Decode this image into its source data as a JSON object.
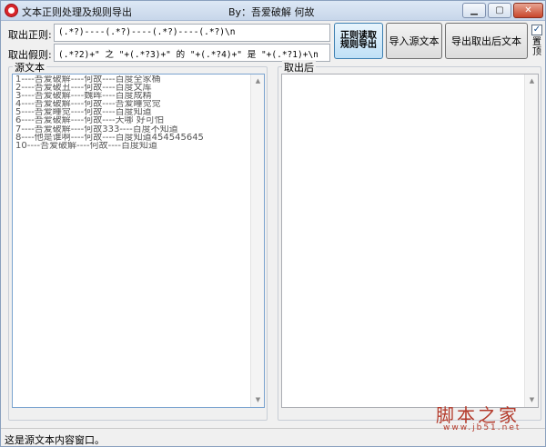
{
  "window": {
    "title": "文本正则处理及规则导出",
    "author": "By：吾爱破解  何故",
    "controls": {
      "minimize": "▁",
      "maximize": "▢",
      "close": "✕"
    }
  },
  "rules": {
    "extract_label": "取出正则:",
    "extract_value": "(.*?)----(.*?)----(.*?)----(.*?)\\n",
    "fake_label": "取出假则:",
    "fake_value": "(.*?2)+\" 之 \"+(.*?3)+\" 的 \"+(.*?4)+\" 是 \"+(.*?1)+\\n"
  },
  "buttons": {
    "read_rules": "正则读取 规则导出",
    "import_source": "导入源文本",
    "export_result": "导出取出后文本"
  },
  "options": {
    "checkbox_checked": true,
    "checkbox_label": "置顶"
  },
  "panels": {
    "source_title": "源文本",
    "result_title": "取出后",
    "source_lines": [
      "1----吾爱破解----何故----百度全家桶",
      "2----吾爱破丑----何故----百度文库",
      "3----吾爱破解----魏晖----百度成精",
      "4----吾爱破解----何故----吾爱睡觉觉",
      "5----吾爱睡觉----何故----百度知道",
      "6----吾爱破解----何故----天哪 好可怕",
      "7----吾爱破解----何故333----百度不知道",
      "8----他是谁啊----何故----百度知道454545645",
      "10----吾爱破解----何故----百度知道"
    ],
    "result_lines": []
  },
  "status": {
    "text": "这是源文本内容窗口。"
  },
  "watermark": {
    "main": "脚本之家",
    "sub": "www.jb51.net"
  },
  "colors": {
    "accent": "#3c7fb1",
    "close": "#c8462b",
    "watermark": "#b43a2b"
  }
}
